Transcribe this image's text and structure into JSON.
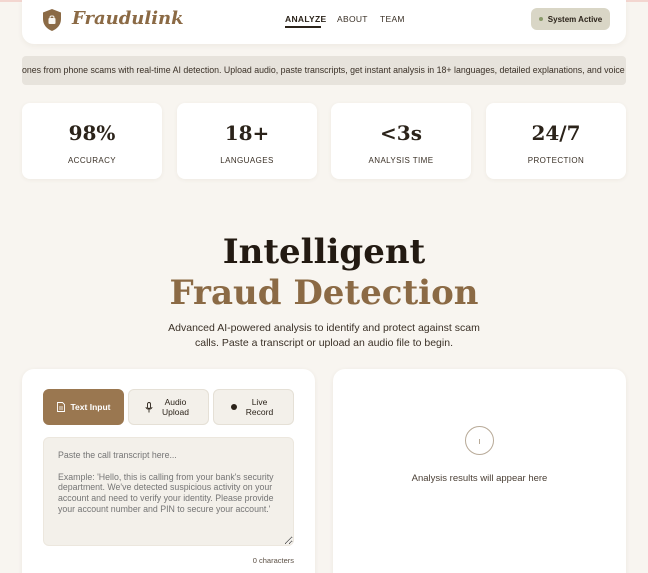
{
  "nav": {
    "brand": "Fraudulink",
    "links": [
      "ANALYZE",
      "ABOUT",
      "TEAM"
    ],
    "status": "System Active"
  },
  "ticker": "ones from phone scams with real-time AI detection. Upload audio, paste transcripts, get instant analysis in 18+ languages, detailed explanations, and voice wa",
  "stats": [
    {
      "value": "98%",
      "label": "ACCURACY"
    },
    {
      "value": "18+",
      "label": "LANGUAGES"
    },
    {
      "value": "<3s",
      "label": "ANALYSIS TIME"
    },
    {
      "value": "24/7",
      "label": "PROTECTION"
    }
  ],
  "hero": {
    "line1": "Intelligent",
    "line2": "Fraud Detection",
    "subtitle": "Advanced AI-powered analysis to identify and protect against scam calls. Paste a transcript or upload an audio file to begin."
  },
  "input": {
    "modes": [
      {
        "label": "Text Input",
        "icon": "document-icon"
      },
      {
        "label": "Audio Upload",
        "icon": "microphone-icon"
      },
      {
        "label": "Live Record",
        "icon": "record-dot-icon"
      }
    ],
    "placeholder": "Paste the call transcript here...\n\nExample: 'Hello, this is calling from your bank's security department. We've detected suspicious activity on your account and need to verify your identity. Please provide your account number and PIN to secure your account.'",
    "char_count": "0 characters"
  },
  "results": {
    "empty_text": "Analysis results will appear here",
    "icon": "info-circle-icon"
  },
  "colors": {
    "accent": "#9a7750",
    "brand": "#8b6a45",
    "background": "#f8f5f0",
    "status_pill": "#d9d6c6"
  }
}
